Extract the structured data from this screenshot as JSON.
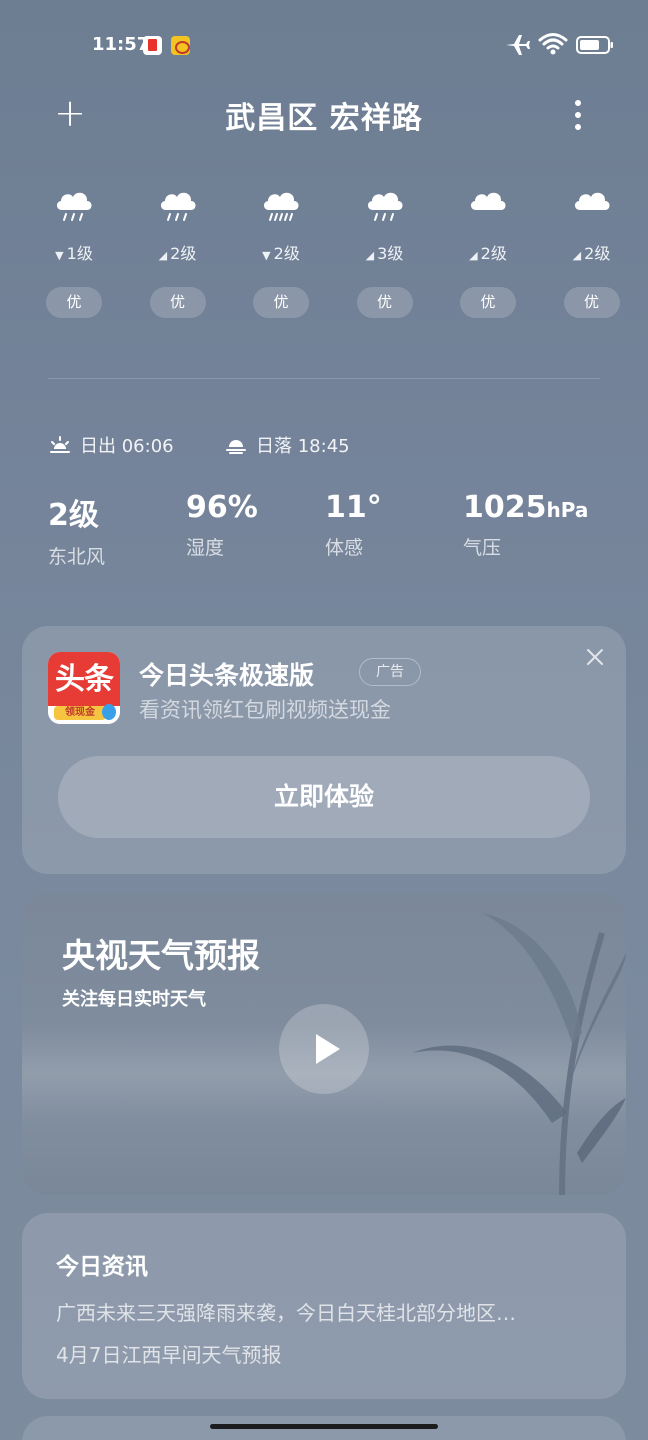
{
  "status_bar": {
    "time": "11:57",
    "icons": [
      "notification-app-icon",
      "weibo-icon",
      "airplane-icon",
      "wifi-icon",
      "battery-icon"
    ]
  },
  "header": {
    "add_label": "+",
    "location": "武昌区 宏祥路"
  },
  "hourly": [
    {
      "icon": "light-rain-icon",
      "wind_dir": "down",
      "wind": "1级",
      "aqi": "优"
    },
    {
      "icon": "light-rain-icon",
      "wind_dir": "up-right",
      "wind": "2级",
      "aqi": "优"
    },
    {
      "icon": "moderate-rain-icon",
      "wind_dir": "down",
      "wind": "2级",
      "aqi": "优"
    },
    {
      "icon": "light-rain-icon",
      "wind_dir": "up-right",
      "wind": "3级",
      "aqi": "优"
    },
    {
      "icon": "cloudy-icon",
      "wind_dir": "up-right",
      "wind": "2级",
      "aqi": "优"
    },
    {
      "icon": "cloudy-icon",
      "wind_dir": "up-right",
      "wind": "2级",
      "aqi": "优"
    }
  ],
  "sun": {
    "sunrise_label": "日出 06:06",
    "sunset_label": "日落 18:45"
  },
  "stats": {
    "wind": {
      "value": "2级",
      "label": "东北风"
    },
    "humidity": {
      "value": "96%",
      "label": "湿度"
    },
    "feels_like": {
      "value": "11°",
      "label": "体感"
    },
    "pressure": {
      "value": "1025",
      "unit": "hPa",
      "label": "气压"
    }
  },
  "ad": {
    "logo_text": "头条",
    "logo_sub": "领现金",
    "title": "今日头条极速版",
    "badge": "广告",
    "subtitle": "看资讯领红包刷视频送现金",
    "cta": "立即体验"
  },
  "video": {
    "title": "央视天气预报",
    "subtitle": "关注每日实时天气"
  },
  "news": {
    "title": "今日资讯",
    "items": [
      "广西未来三天强降雨来袭，今日白天桂北部分地区…",
      "4月7日江西早间天气预报"
    ]
  },
  "colors": {
    "background": "#75849a",
    "ad_logo_red": "#e73b35",
    "ad_logo_yellow": "#f5c540"
  }
}
